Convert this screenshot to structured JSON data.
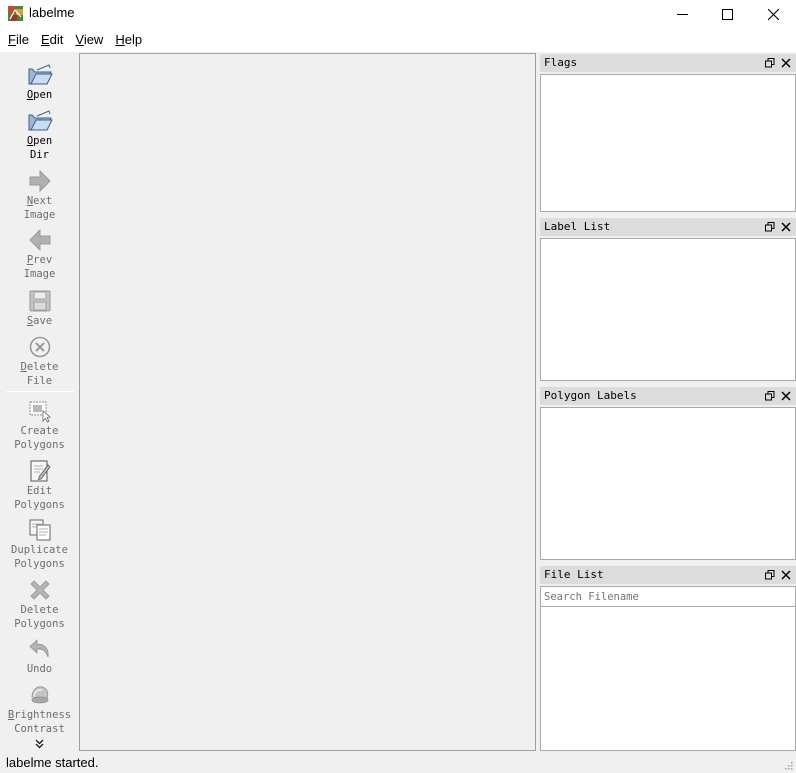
{
  "window": {
    "title": "labelme"
  },
  "menu": [
    {
      "label": "File",
      "mnemonic": "F",
      "rest": "ile"
    },
    {
      "label": "Edit",
      "mnemonic": "E",
      "rest": "dit"
    },
    {
      "label": "View",
      "mnemonic": "V",
      "rest": "iew"
    },
    {
      "label": "Help",
      "mnemonic": "H",
      "rest": "elp"
    }
  ],
  "toolbar": {
    "open": {
      "mn": "O",
      "rest": "pen",
      "icon": "folder-open-icon",
      "enabled": true
    },
    "open_dir": {
      "mn": "O",
      "rest": "pen\nDir",
      "icon": "folder-open-icon",
      "enabled": true
    },
    "next_image": {
      "mn": "N",
      "rest": "ext\nImage",
      "icon": "arrow-right-icon",
      "enabled": false
    },
    "prev_image": {
      "mn": "P",
      "rest": "rev\nImage",
      "icon": "arrow-left-icon",
      "enabled": false
    },
    "save": {
      "mn": "S",
      "rest": "ave",
      "icon": "save-icon",
      "enabled": false
    },
    "delete_file": {
      "mn": "D",
      "rest": "elete\nFile",
      "icon": "delete-circle-icon",
      "enabled": false
    },
    "create_polygons": {
      "mn": "",
      "rest": "Create\nPolygons",
      "icon": "create-polygon-icon",
      "enabled": false
    },
    "edit_polygons": {
      "mn": "",
      "rest": "Edit\nPolygons",
      "icon": "edit-icon",
      "enabled": false
    },
    "duplicate_polygons": {
      "mn": "",
      "rest": "Duplicate\nPolygons",
      "icon": "duplicate-icon",
      "enabled": false
    },
    "delete_polygons": {
      "mn": "",
      "rest": "Delete\nPolygons",
      "icon": "cross-icon",
      "enabled": false
    },
    "undo": {
      "mn": "",
      "rest": "Undo",
      "icon": "undo-icon",
      "enabled": false
    },
    "brightness_contrast": {
      "mn": "B",
      "rest": "rightness\nContrast",
      "icon": "brightness-icon",
      "enabled": false
    }
  },
  "docks": {
    "flags": {
      "title": "Flags"
    },
    "label_list": {
      "title": "Label List"
    },
    "polygon_labels": {
      "title": "Polygon Labels"
    },
    "file_list": {
      "title": "File List",
      "search_placeholder": "Search Filename",
      "search_value": ""
    }
  },
  "status": {
    "text": "labelme started."
  },
  "colors": {
    "titlebar": "#ffffff",
    "chrome": "#f0f0f0",
    "dock_title": "#dcdcdc",
    "list_bg": "#ffffff",
    "disabled_text": "#6d6d6d"
  }
}
